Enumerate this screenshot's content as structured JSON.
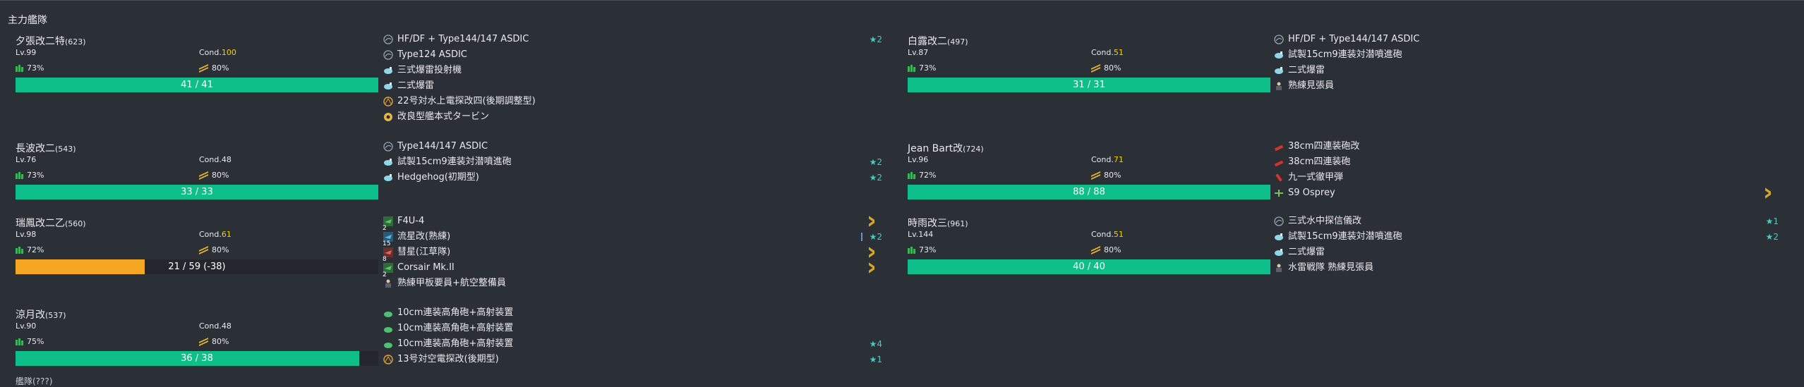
{
  "fleet_title": "主力艦隊",
  "cutoff_text": "艦隊(???)",
  "ships": [
    {
      "name": "夕張改二特",
      "id": "(623)",
      "lv": "Lv.99",
      "cond_label": "Cond.",
      "cond": "100",
      "cond_class": "cond-sp",
      "fuel": "73%",
      "ammo": "80%",
      "hp_text": "41 / 41",
      "hp_fraction": 1.0,
      "hp_color": "fill-green",
      "equips": [
        {
          "name": "HF/DF + Type144/147 ASDIC",
          "icon": "sonar-icon",
          "extra": "★2"
        },
        {
          "name": "Type124 ASDIC",
          "icon": "sonar-icon",
          "extra": ""
        },
        {
          "name": "三式爆雷投射機",
          "icon": "depth-charge-icon",
          "extra": ""
        },
        {
          "name": "二式爆雷",
          "icon": "depth-charge-icon",
          "extra": ""
        },
        {
          "name": "22号対水上電探改四(後期調整型)",
          "icon": "radar-icon",
          "extra": ""
        },
        {
          "name": "改良型艦本式タービン",
          "icon": "turbine-icon",
          "extra": ""
        }
      ]
    },
    {
      "name": "白露改二",
      "id": "(497)",
      "lv": "Lv.87",
      "cond_label": "Cond.",
      "cond": "51",
      "cond_class": "cond-high",
      "fuel": "73%",
      "ammo": "80%",
      "hp_text": "31 / 31",
      "hp_fraction": 1.0,
      "hp_color": "fill-green",
      "equips": [
        {
          "name": "HF/DF + Type144/147 ASDIC",
          "icon": "sonar-icon",
          "extra": ""
        },
        {
          "name": "試製15cm9連装対潜噴進砲",
          "icon": "depth-charge-icon",
          "extra": ""
        },
        {
          "name": "二式爆雷",
          "icon": "depth-charge-icon",
          "extra": ""
        },
        {
          "name": "熟練見張員",
          "icon": "lookout-icon",
          "extra": ""
        }
      ]
    },
    {
      "name": "長波改二",
      "id": "(543)",
      "lv": "Lv.76",
      "cond_label": "Cond.",
      "cond": "48",
      "cond_class": "cond-norm",
      "fuel": "73%",
      "ammo": "80%",
      "hp_text": "33 / 33",
      "hp_fraction": 1.0,
      "hp_color": "fill-green",
      "equips": [
        {
          "name": "Type144/147 ASDIC",
          "icon": "sonar-icon",
          "extra": ""
        },
        {
          "name": "試製15cm9連装対潜噴進砲",
          "icon": "depth-charge-icon",
          "extra": "★2"
        },
        {
          "name": "Hedgehog(初期型)",
          "icon": "depth-charge-icon",
          "extra": "★2"
        }
      ]
    },
    {
      "name": "Jean Bart改",
      "id": "(724)",
      "lv": "Lv.96",
      "cond_label": "Cond.",
      "cond": "71",
      "cond_class": "cond-high",
      "fuel": "72%",
      "ammo": "80%",
      "hp_text": "88 / 88",
      "hp_fraction": 1.0,
      "hp_color": "fill-green",
      "equips": [
        {
          "name": "38cm四連装砲改",
          "icon": "main-gun-icon",
          "extra": ""
        },
        {
          "name": "38cm四連装砲",
          "icon": "main-gun-icon",
          "extra": ""
        },
        {
          "name": "九一式徹甲弾",
          "icon": "ap-shell-icon",
          "extra": ""
        },
        {
          "name": "S9 Osprey",
          "icon": "seaplane-icon",
          "extra": "chevron"
        }
      ]
    },
    {
      "name": "瑞鳳改二乙",
      "id": "(560)",
      "lv": "Lv.98",
      "cond_label": "Cond.",
      "cond": "61",
      "cond_class": "cond-high",
      "fuel": "72%",
      "ammo": "80%",
      "hp_text": "21 / 59 (-38)",
      "hp_fraction": 0.356,
      "hp_color": "fill-orange",
      "equips": [
        {
          "name": "F4U-4",
          "icon": "fighter-icon",
          "extra": "chevron",
          "slot": "2"
        },
        {
          "name": "流星改(熟練)",
          "icon": "torpedo-bomber-icon",
          "extra": "★2",
          "slot": "15",
          "bar": true
        },
        {
          "name": "彗星(江草隊)",
          "icon": "dive-bomber-icon",
          "extra": "chevron",
          "slot": "8"
        },
        {
          "name": "Corsair Mk.II",
          "icon": "fighter-icon",
          "extra": "chevron",
          "slot": "2"
        },
        {
          "name": "熟練甲板要員+航空整備員",
          "icon": "lookout-icon",
          "extra": ""
        }
      ]
    },
    {
      "name": "時雨改三",
      "id": "(961)",
      "lv": "Lv.144",
      "cond_label": "Cond.",
      "cond": "51",
      "cond_class": "cond-high",
      "fuel": "73%",
      "ammo": "80%",
      "hp_text": "40 / 40",
      "hp_fraction": 1.0,
      "hp_color": "fill-green",
      "equips": [
        {
          "name": "三式水中探信儀改",
          "icon": "sonar-icon",
          "extra": "★1"
        },
        {
          "name": "試製15cm9連装対潜噴進砲",
          "icon": "depth-charge-icon",
          "extra": "★2"
        },
        {
          "name": "二式爆雷",
          "icon": "depth-charge-icon",
          "extra": ""
        },
        {
          "name": "水雷戦隊 熟練見張員",
          "icon": "lookout-icon",
          "extra": ""
        }
      ]
    },
    {
      "name": "涼月改",
      "id": "(537)",
      "lv": "Lv.90",
      "cond_label": "Cond.",
      "cond": "48",
      "cond_class": "cond-norm",
      "fuel": "75%",
      "ammo": "80%",
      "hp_text": "36 / 38",
      "hp_fraction": 0.947,
      "hp_color": "fill-green",
      "equips": [
        {
          "name": "10cm連装高角砲+高射装置",
          "icon": "aa-gun-icon",
          "extra": ""
        },
        {
          "name": "10cm連装高角砲+高射装置",
          "icon": "aa-gun-icon",
          "extra": ""
        },
        {
          "name": "10cm連装高角砲+高射装置",
          "icon": "aa-gun-icon",
          "extra": "★4"
        },
        {
          "name": "13号対空電探改(後期型)",
          "icon": "radar-icon",
          "extra": "★1"
        }
      ]
    }
  ]
}
